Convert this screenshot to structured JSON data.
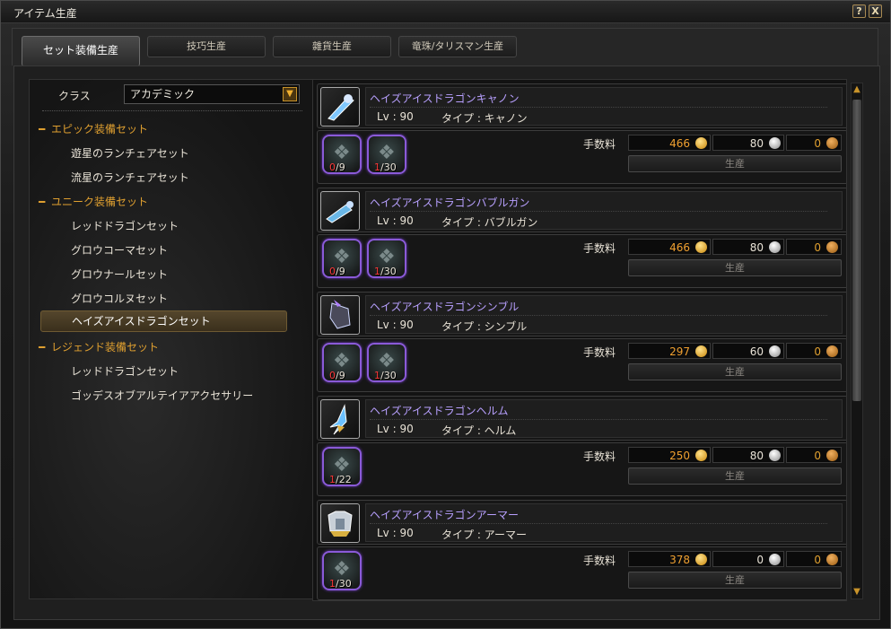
{
  "window": {
    "title": "アイテム生産",
    "help_label": "?",
    "close_label": "X"
  },
  "tabs": [
    {
      "label": "セット装備生産",
      "active": true
    },
    {
      "label": "技巧生産",
      "active": false
    },
    {
      "label": "雜貨生産",
      "active": false
    },
    {
      "label": "竜珠/タリスマン生産",
      "active": false
    }
  ],
  "filter": {
    "class_label": "クラス",
    "class_value": "アカデミック"
  },
  "tree": {
    "cat1": {
      "label": "エピック装備セット",
      "marker": "━"
    },
    "cat1_items": [
      "遊星のランチェアセット",
      "流星のランチェアセット"
    ],
    "cat2": {
      "label": "ユニーク装備セット",
      "marker": "━"
    },
    "cat2_items": [
      "レッドドラゴンセット",
      "グロウコーマセット",
      "グロウナールセット",
      "グロウコルヌセット",
      "ヘイズアイスドラゴンセット"
    ],
    "cat3": {
      "label": "レジェンド装備セット",
      "marker": "━"
    },
    "cat3_items": [
      "レッドドラゴンセット",
      "ゴッデスオブアルテイアアクセサリー"
    ]
  },
  "recipes": [
    {
      "name": "ヘイズアイスドラゴンキャノン",
      "level": "Lv : 90",
      "type": "タイプ : キャノン",
      "materials": [
        {
          "have": "0",
          "need": "/9"
        },
        {
          "have": "1",
          "need": "/30"
        }
      ],
      "fee_label": "手数料",
      "gold": "466",
      "silver": "80",
      "copper": "0",
      "produce_label": "生産"
    },
    {
      "name": "ヘイズアイスドラゴンバブルガン",
      "level": "Lv : 90",
      "type": "タイプ : バブルガン",
      "materials": [
        {
          "have": "0",
          "need": "/9"
        },
        {
          "have": "1",
          "need": "/30"
        }
      ],
      "fee_label": "手数料",
      "gold": "466",
      "silver": "80",
      "copper": "0",
      "produce_label": "生産"
    },
    {
      "name": "ヘイズアイスドラゴンシンブル",
      "level": "Lv : 90",
      "type": "タイプ : シンブル",
      "materials": [
        {
          "have": "0",
          "need": "/9"
        },
        {
          "have": "1",
          "need": "/30"
        }
      ],
      "fee_label": "手数料",
      "gold": "297",
      "silver": "60",
      "copper": "0",
      "produce_label": "生産"
    },
    {
      "name": "ヘイズアイスドラゴンヘルム",
      "level": "Lv : 90",
      "type": "タイプ : ヘルム",
      "materials": [
        {
          "have": "1",
          "need": "/22"
        }
      ],
      "fee_label": "手数料",
      "gold": "250",
      "silver": "80",
      "copper": "0",
      "produce_label": "生産"
    },
    {
      "name": "ヘイズアイスドラゴンアーマー",
      "level": "Lv : 90",
      "type": "タイプ : アーマー",
      "materials": [
        {
          "have": "1",
          "need": "/30"
        }
      ],
      "fee_label": "手数料",
      "gold": "378",
      "silver": "0",
      "copper": "0",
      "produce_label": "生産"
    }
  ],
  "colors": {
    "item_name": "#b8a0ff",
    "category": "#e0a030",
    "fee_value": "#f0a030",
    "fee_zero": "#e0a030",
    "material_have": "#ff3a3a"
  },
  "icons": {
    "recipe_icons": [
      "cannon-icon",
      "bubblegun-icon",
      "thimble-icon",
      "helm-icon",
      "armor-icon"
    ],
    "material_icon": "dragon-material-icon"
  }
}
